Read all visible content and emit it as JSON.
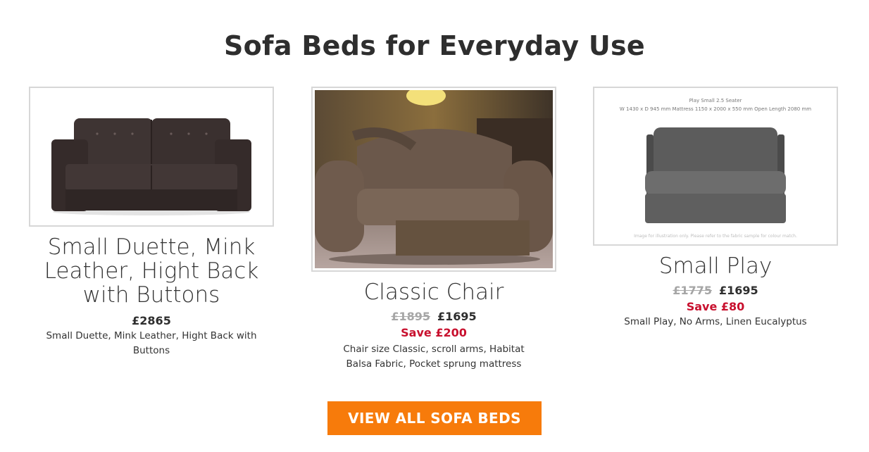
{
  "page": {
    "title": "Sofa Beds for Everyday Use"
  },
  "products": [
    {
      "name": "Small Duette, Mink Leather, Hight Back with Buttons",
      "price": "£2865",
      "description": "Small Duette, Mink Leather, Hight Back with Buttons",
      "image_icon": "sofa-two-seater-leather"
    },
    {
      "name": "Classic Chair",
      "old_price": "£1895",
      "price": "£1695",
      "save": "Save £200",
      "description": "Chair size Classic, scroll arms, Habitat Balsa Fabric, Pocket sprung mattress",
      "image_icon": "armchair-fabric"
    },
    {
      "name": "Small Play",
      "old_price": "£1775",
      "price": "£1695",
      "save": "Save £80",
      "description": "Small Play, No Arms, Linen Eucalyptus",
      "image_icon": "sofa-no-arms-grey",
      "image_caption": "Play Small 2.5 Seater",
      "image_dims": "W 1430 x D 945 mm     Mattress 1150 x 2000 x 550 mm     Open Length 2080 mm",
      "image_footnote": "Image for illustration only. Please refer to the fabric sample for colour match."
    }
  ],
  "cta": {
    "label": "VIEW ALL SOFA BEDS"
  },
  "colors": {
    "accent": "#f77b0b",
    "save": "#c8102e",
    "old_price": "#a6a6a6"
  }
}
